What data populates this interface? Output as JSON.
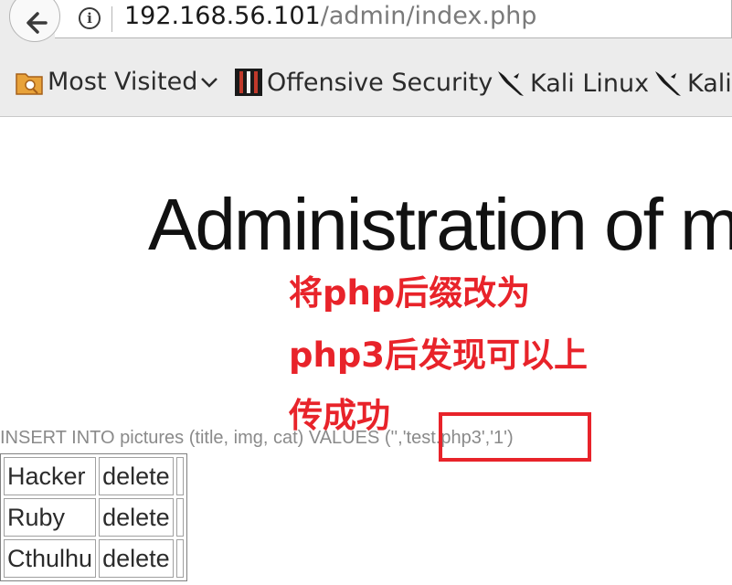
{
  "browser": {
    "url_host": "192.168.56.101",
    "url_path": "/admin/index.php",
    "bookmarks": [
      {
        "label": "Most Visited",
        "icon": "folder-icon"
      },
      {
        "label": "Offensive Security",
        "icon": "offsec-icon"
      },
      {
        "label": "Kali Linux",
        "icon": "kali-dragon-icon"
      },
      {
        "label": "Kali",
        "icon": "kali-dragon-icon"
      }
    ]
  },
  "page": {
    "heading": "Administration of m",
    "annotation_lines": [
      "将php后缀改为",
      "php3后发现可以上",
      "传成功"
    ],
    "sql_prefix": "INSERT INTO pictures (title, img, cat) VALUES ",
    "sql_values": "('','test.php3','1')",
    "rows": [
      {
        "title": "Hacker",
        "action": "delete"
      },
      {
        "title": "Ruby",
        "action": "delete"
      },
      {
        "title": "Cthulhu",
        "action": "delete"
      }
    ]
  },
  "colors": {
    "annotation": "#e8232a",
    "chrome": "#ececec"
  }
}
